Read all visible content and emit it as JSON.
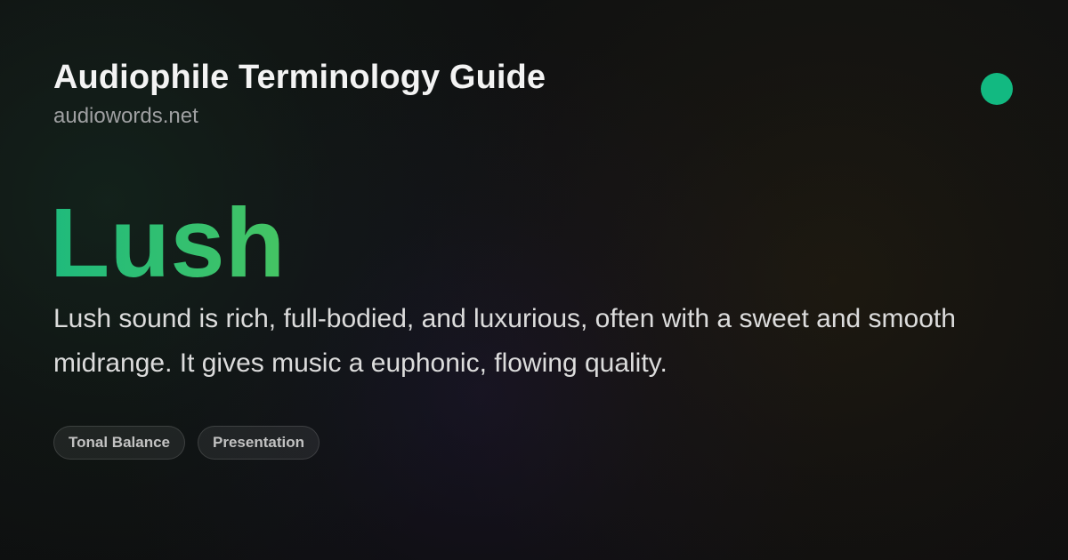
{
  "header": {
    "title": "Audiophile Terminology Guide",
    "domain": "audiowords.net",
    "status_dot_color": "#12b981"
  },
  "entry": {
    "term": "Lush",
    "term_colors": [
      "#1fba7c",
      "#45c463"
    ],
    "definition": "Lush sound is rich, full-bodied, and luxurious, often with a sweet and smooth midrange. It gives music a euphonic, flowing quality."
  },
  "tags": [
    {
      "label": "Tonal Balance"
    },
    {
      "label": "Presentation"
    }
  ]
}
